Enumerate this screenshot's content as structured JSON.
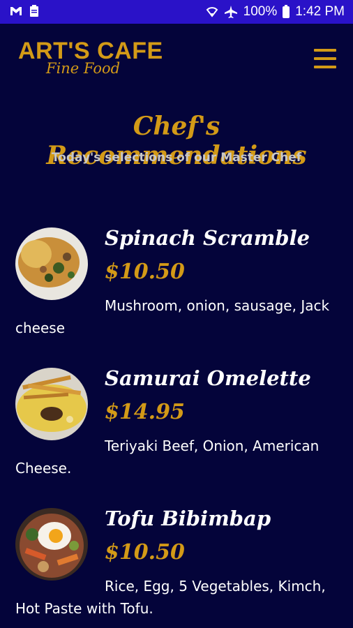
{
  "status": {
    "battery": "100%",
    "time": "1:42 PM"
  },
  "header": {
    "logo_main": "ART'S CAFE",
    "logo_sub": "Fine Food"
  },
  "page": {
    "title": "Chef's Recommendations",
    "subtitle": "Today's selections of our Master Chef"
  },
  "items": [
    {
      "name": "Spinach Scramble",
      "price": "$10.50",
      "description": "Mushroom, onion, sausage, Jack cheese"
    },
    {
      "name": "Samurai Omelette",
      "price": "$14.95",
      "description": "Teriyaki Beef, Onion, American Cheese."
    },
    {
      "name": "Tofu Bibimbap",
      "price": "$10.50",
      "description": "Rice, Egg, 5 Vegetables, Kimch, Hot Paste with Tofu."
    }
  ],
  "colors": {
    "accent": "#d39a17",
    "background": "#04043a",
    "statusbar": "#2a12c8"
  }
}
